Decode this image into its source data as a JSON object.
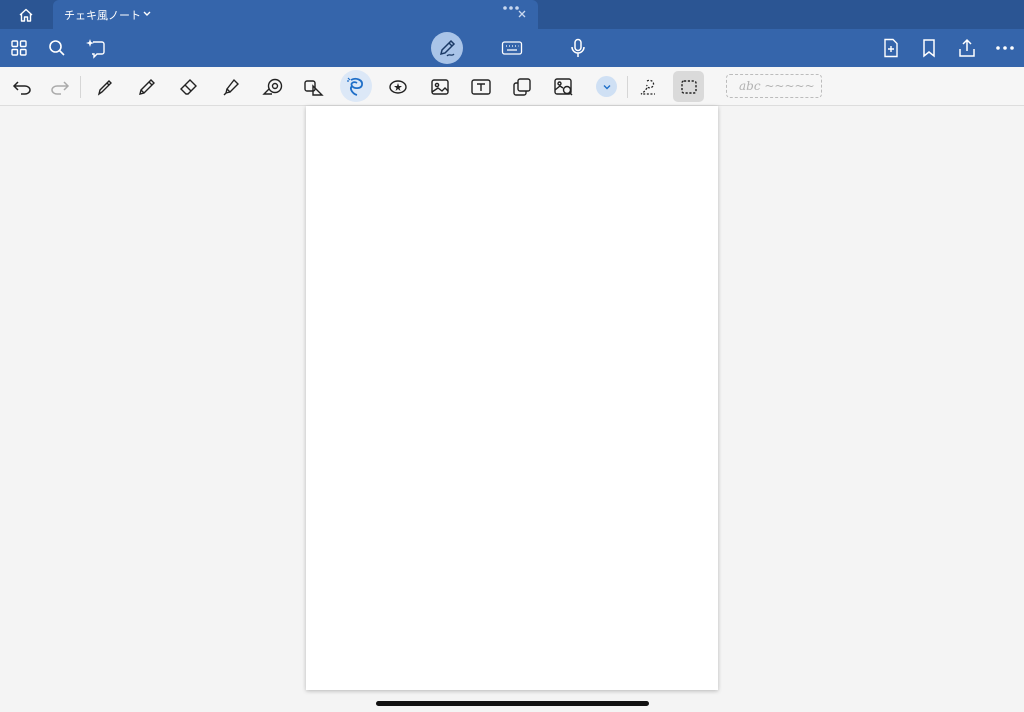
{
  "tab": {
    "title": "チェキ風ノート"
  },
  "icons": {
    "tabbar": [
      "home-icon",
      "chevron-down-icon",
      "more-dots-icon",
      "close-icon"
    ],
    "mainbar_left": [
      "grid-icon",
      "search-icon",
      "sparkle-icon"
    ],
    "mainbar_center": [
      "pen-mode-icon",
      "keyboard-icon",
      "microphone-icon"
    ],
    "mainbar_right": [
      "add-page-icon",
      "bookmark-icon",
      "share-icon",
      "more-icon"
    ],
    "tools": [
      "undo-icon",
      "redo-icon",
      "pen-icon",
      "pencil-icon",
      "eraser-icon",
      "highlighter-icon",
      "tape-icon",
      "shape-icon",
      "lasso-icon",
      "sticker-icon",
      "image-icon",
      "textbox-icon",
      "sticky-note-icon",
      "camera-icon",
      "chevron-down-icon",
      "lasso-select-icon",
      "rectangle-select-icon"
    ]
  },
  "toolbar": {
    "convert_placeholder": "abc ~~~~~"
  },
  "colors": {
    "tabbar_bg": "#2b5593",
    "toolbar_bg": "#3565ab",
    "accent": "#1f6fc8",
    "page_bg": "#ffffff",
    "workspace_bg": "#f4f4f4"
  }
}
